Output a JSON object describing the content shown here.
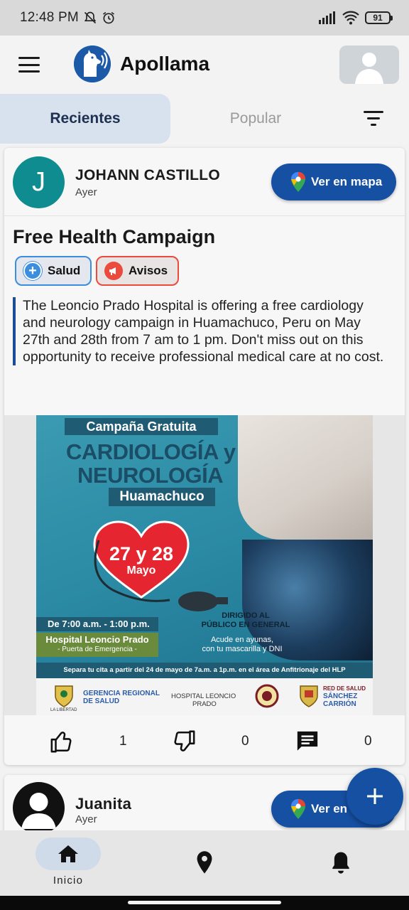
{
  "status_bar": {
    "time": "12:48 PM",
    "battery": "91"
  },
  "app": {
    "title": "Apollama"
  },
  "tabs": [
    {
      "label": "Recientes",
      "active": true
    },
    {
      "label": "Popular",
      "active": false
    }
  ],
  "posts": [
    {
      "author_initial": "J",
      "author": "JOHANN CASTILLO",
      "time": "Ayer",
      "map_button": "Ver en mapa",
      "title": "Free Health Campaign",
      "tags": [
        {
          "label": "Salud",
          "color": "#3a8ddf"
        },
        {
          "label": "Avisos",
          "color": "#ea4b3c"
        }
      ],
      "body": "The Leoncio Prado Hospital is offering a free cardiology and neurology campaign in Huamachuco, Peru on May 27th and 28th from 7 am to 1 pm. Don't miss out on this opportunity to receive professional medical care at no cost.",
      "poster": {
        "banner": "Campaña Gratuita",
        "line1": "CARDIOLOGÍA y",
        "line2": "NEUROLOGÍA",
        "location": "Huamachuco",
        "date_line1": "27 y 28",
        "date_line2": "Mayo",
        "hours": "De 7:00 a.m. - 1:00 p.m.",
        "hospital": "Hospital Leoncio Prado",
        "door": "- Puerta de Emergencia -",
        "audience_1": "DIRIGIDO AL",
        "audience_2": "PÚBLICO EN GENERAL",
        "note_1": "Acude en ayunas,",
        "note_2": "con tu mascarilla y DNI",
        "appointment": "Separa tu cita a partir del 24 de mayo de 7a.m. a 1p.m. en el área de Anfitrionaje del HLP",
        "logo_1a": "GERENCIA REGIONAL",
        "logo_1b": "DE SALUD",
        "logo_2a": "HOSPITAL LEONCIO",
        "logo_2b": "PRADO",
        "logo_3a": "RED DE SALUD",
        "logo_3b": "SÁNCHEZ",
        "logo_3c": "CARRIÓN",
        "libertad": "LA LIBERTAD"
      },
      "likes": "1",
      "dislikes": "0",
      "comments": "0"
    },
    {
      "author": "Juanita",
      "time": "Ayer",
      "map_button": "Ver en mapa"
    }
  ],
  "bottom_nav": {
    "home_label": "Inicio"
  },
  "colors": {
    "primary": "#1650a3",
    "tab_active_bg": "#d8e1ee",
    "avatar_teal": "#0e8c8f"
  }
}
